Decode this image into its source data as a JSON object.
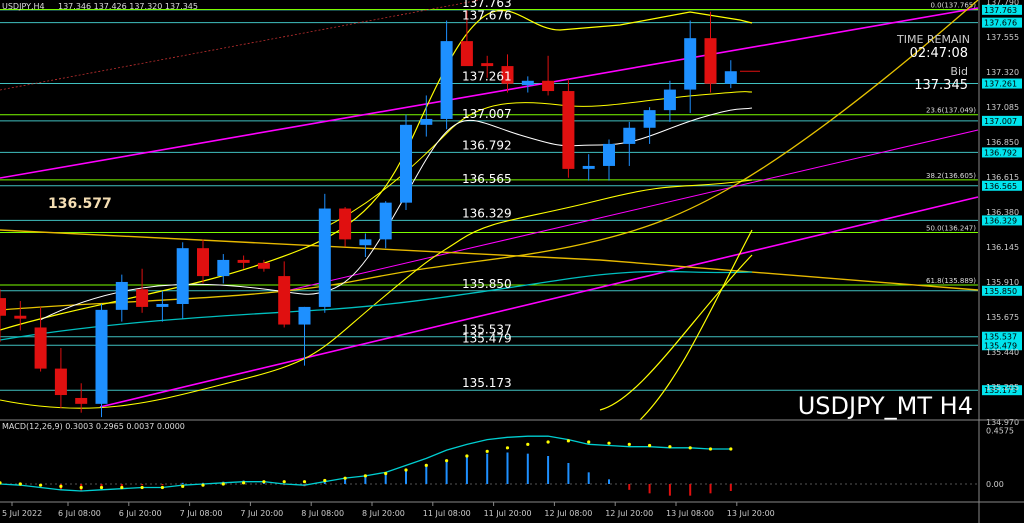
{
  "header": {
    "symbol_label": "USDJPY,H4",
    "ohlc_values": "137.346 137.426 137.320 137.345"
  },
  "watermark": "USDJPY_MT H4",
  "left_price_label": "136.577",
  "info_box": {
    "time_remain_label": "TIME REMAIN",
    "time_remain_value": "02:47:08",
    "bid_label": "Bid",
    "bid_value": "137.345"
  },
  "colors": {
    "background": "#000000",
    "bull": "#1e90ff",
    "bear": "#e01010",
    "level": "#40c0c0",
    "level_label_bg": "#00e5ee",
    "fib": "#7cfc00",
    "magenta": "#ff00ff",
    "yellow": "#ffff00",
    "macd": "#00ced1"
  },
  "chart_data": {
    "type": "candlestick",
    "price_axis": {
      "range": [
        134.97,
        137.83
      ],
      "ticks": [
        "137.790",
        "137.555",
        "137.320",
        "137.085",
        "136.850",
        "136.615",
        "136.380",
        "136.145",
        "135.910",
        "135.675",
        "135.440",
        "135.205",
        "134.970"
      ]
    },
    "time_axis": {
      "labels": [
        "5 Jul 2022",
        "6 Jul 08:00",
        "6 Jul 20:00",
        "7 Jul 08:00",
        "7 Jul 20:00",
        "8 Jul 08:00",
        "8 Jul 20:00",
        "11 Jul 08:00",
        "11 Jul 20:00",
        "12 Jul 08:00",
        "12 Jul 20:00",
        "13 Jul 08:00",
        "13 Jul 20:00"
      ]
    },
    "horizontal_levels": [
      {
        "price": 137.763,
        "label": "137.763"
      },
      {
        "price": 137.676,
        "label": "137.676"
      },
      {
        "price": 137.261,
        "label": "137.261"
      },
      {
        "price": 137.007,
        "label": "137.007"
      },
      {
        "price": 136.792,
        "label": "136.792"
      },
      {
        "price": 136.565,
        "label": "136.565"
      },
      {
        "price": 136.329,
        "label": "136.329"
      },
      {
        "price": 135.85,
        "label": "135.850"
      },
      {
        "price": 135.537,
        "label": "135.537"
      },
      {
        "price": 135.479,
        "label": "135.479"
      },
      {
        "price": 135.173,
        "label": "135.173"
      }
    ],
    "fibonacci": [
      {
        "price": 137.765,
        "label": "0.0(137.765)"
      },
      {
        "price": 137.049,
        "label": "23.6(137.049)"
      },
      {
        "price": 136.605,
        "label": "38.2(136.605)"
      },
      {
        "price": 136.247,
        "label": "50.0(136.247)"
      },
      {
        "price": 135.889,
        "label": "61.8(135.889)"
      }
    ],
    "bid_price": 137.345,
    "candles": [
      {
        "o": 135.8,
        "h": 135.86,
        "l": 135.5,
        "c": 135.68
      },
      {
        "o": 135.68,
        "h": 135.78,
        "l": 135.58,
        "c": 135.66
      },
      {
        "o": 135.6,
        "h": 135.74,
        "l": 135.3,
        "c": 135.32
      },
      {
        "o": 135.32,
        "h": 135.46,
        "l": 135.05,
        "c": 135.14
      },
      {
        "o": 135.12,
        "h": 135.22,
        "l": 135.02,
        "c": 135.08
      },
      {
        "o": 135.08,
        "h": 135.76,
        "l": 134.99,
        "c": 135.72
      },
      {
        "o": 135.72,
        "h": 135.96,
        "l": 135.64,
        "c": 135.91
      },
      {
        "o": 135.86,
        "h": 136.0,
        "l": 135.7,
        "c": 135.74
      },
      {
        "o": 135.74,
        "h": 135.85,
        "l": 135.64,
        "c": 135.76
      },
      {
        "o": 135.76,
        "h": 136.18,
        "l": 135.66,
        "c": 136.14
      },
      {
        "o": 136.14,
        "h": 136.2,
        "l": 135.9,
        "c": 135.95
      },
      {
        "o": 135.95,
        "h": 136.1,
        "l": 135.9,
        "c": 136.06
      },
      {
        "o": 136.06,
        "h": 136.09,
        "l": 136.0,
        "c": 136.04
      },
      {
        "o": 136.04,
        "h": 136.06,
        "l": 135.98,
        "c": 136.0
      },
      {
        "o": 135.95,
        "h": 136.05,
        "l": 135.6,
        "c": 135.62
      },
      {
        "o": 135.62,
        "h": 135.74,
        "l": 135.34,
        "c": 135.74
      },
      {
        "o": 135.74,
        "h": 136.51,
        "l": 135.7,
        "c": 136.41
      },
      {
        "o": 136.41,
        "h": 136.42,
        "l": 136.15,
        "c": 136.2
      },
      {
        "o": 136.16,
        "h": 136.24,
        "l": 136.08,
        "c": 136.2
      },
      {
        "o": 136.2,
        "h": 136.46,
        "l": 136.14,
        "c": 136.45
      },
      {
        "o": 136.45,
        "h": 137.05,
        "l": 136.4,
        "c": 136.98
      },
      {
        "o": 136.98,
        "h": 137.18,
        "l": 136.9,
        "c": 137.02
      },
      {
        "o": 137.02,
        "h": 137.69,
        "l": 136.95,
        "c": 137.55
      },
      {
        "o": 137.55,
        "h": 137.76,
        "l": 137.4,
        "c": 137.38
      },
      {
        "o": 137.4,
        "h": 137.45,
        "l": 137.3,
        "c": 137.38
      },
      {
        "o": 137.38,
        "h": 137.46,
        "l": 137.2,
        "c": 137.26
      },
      {
        "o": 137.25,
        "h": 137.31,
        "l": 137.2,
        "c": 137.28
      },
      {
        "o": 137.28,
        "h": 137.45,
        "l": 137.18,
        "c": 137.21
      },
      {
        "o": 137.21,
        "h": 137.29,
        "l": 136.62,
        "c": 136.68
      },
      {
        "o": 136.68,
        "h": 136.78,
        "l": 136.6,
        "c": 136.7
      },
      {
        "o": 136.7,
        "h": 136.88,
        "l": 136.6,
        "c": 136.85
      },
      {
        "o": 136.85,
        "h": 137.0,
        "l": 136.7,
        "c": 136.96
      },
      {
        "o": 136.96,
        "h": 137.1,
        "l": 136.85,
        "c": 137.08
      },
      {
        "o": 137.08,
        "h": 137.28,
        "l": 137.0,
        "c": 137.22
      },
      {
        "o": 137.22,
        "h": 137.69,
        "l": 137.06,
        "c": 137.57
      },
      {
        "o": 137.57,
        "h": 137.75,
        "l": 137.2,
        "c": 137.26
      },
      {
        "o": 137.26,
        "h": 137.42,
        "l": 137.23,
        "c": 137.345
      }
    ],
    "macd": {
      "label": "MACD(12,26,9) 0.3003 0.2965 0.0037 0.0000",
      "range": [
        -0.12,
        0.48
      ],
      "ticks": [
        "0.4575",
        "0.00"
      ],
      "histogram": [
        0.02,
        0.01,
        -0.02,
        -0.05,
        -0.06,
        -0.04,
        -0.02,
        -0.01,
        -0.01,
        0.01,
        0.01,
        0.02,
        0.03,
        0.02,
        -0.01,
        -0.02,
        0.03,
        0.05,
        0.06,
        0.08,
        0.12,
        0.15,
        0.2,
        0.24,
        0.26,
        0.27,
        0.26,
        0.24,
        0.18,
        0.1,
        0.04,
        -0.05,
        -0.08,
        -0.1,
        -0.1,
        -0.08,
        -0.06
      ],
      "macd_line": [
        0.0,
        -0.01,
        -0.03,
        -0.05,
        -0.06,
        -0.05,
        -0.04,
        -0.03,
        -0.03,
        -0.01,
        0.0,
        0.01,
        0.02,
        0.02,
        0.0,
        -0.01,
        0.02,
        0.05,
        0.07,
        0.1,
        0.16,
        0.22,
        0.29,
        0.34,
        0.38,
        0.4,
        0.41,
        0.41,
        0.38,
        0.34,
        0.33,
        0.32,
        0.32,
        0.31,
        0.31,
        0.3,
        0.3
      ],
      "signal_dots": [
        0.01,
        0.0,
        -0.01,
        -0.02,
        -0.03,
        -0.03,
        -0.03,
        -0.03,
        -0.03,
        -0.02,
        -0.01,
        0.0,
        0.01,
        0.02,
        0.02,
        0.02,
        0.03,
        0.05,
        0.07,
        0.09,
        0.12,
        0.16,
        0.2,
        0.24,
        0.28,
        0.31,
        0.34,
        0.36,
        0.37,
        0.36,
        0.35,
        0.34,
        0.33,
        0.32,
        0.31,
        0.3,
        0.3
      ]
    }
  }
}
